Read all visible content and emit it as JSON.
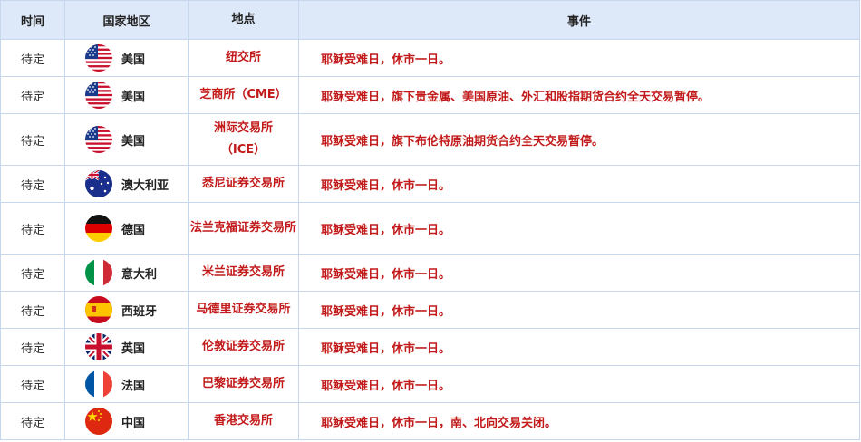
{
  "headers": {
    "time": "时间",
    "country": "国家地区",
    "place": "地点",
    "event": "事件"
  },
  "rows": [
    {
      "time": "待定",
      "flag": "us-flag-icon",
      "country": "美国",
      "place": "纽交所",
      "event": "耶稣受难日，休市一日。"
    },
    {
      "time": "待定",
      "flag": "us-flag-icon",
      "country": "美国",
      "place": "芝商所（CME）",
      "event": "耶稣受难日，旗下贵金属、美国原油、外汇和股指期货合约全天交易暂停。"
    },
    {
      "time": "待定",
      "flag": "us-flag-icon",
      "country": "美国",
      "place": "洲际交易所（ICE）",
      "event": "耶稣受难日，旗下布伦特原油期货合约全天交易暂停。"
    },
    {
      "time": "待定",
      "flag": "au-flag-icon",
      "country": "澳大利亚",
      "place": "悉尼证券交易所",
      "event": "耶稣受难日，休市一日。"
    },
    {
      "time": "待定",
      "flag": "de-flag-icon",
      "country": "德国",
      "place": "法兰克福证券交易所",
      "event": "耶稣受难日，休市一日。"
    },
    {
      "time": "待定",
      "flag": "it-flag-icon",
      "country": "意大利",
      "place": "米兰证券交易所",
      "event": "耶稣受难日，休市一日。"
    },
    {
      "time": "待定",
      "flag": "es-flag-icon",
      "country": "西班牙",
      "place": "马德里证券交易所",
      "event": "耶稣受难日，休市一日。"
    },
    {
      "time": "待定",
      "flag": "gb-flag-icon",
      "country": "英国",
      "place": "伦敦证券交易所",
      "event": "耶稣受难日，休市一日。"
    },
    {
      "time": "待定",
      "flag": "fr-flag-icon",
      "country": "法国",
      "place": "巴黎证券交易所",
      "event": "耶稣受难日，休市一日。"
    },
    {
      "time": "待定",
      "flag": "cn-flag-icon",
      "country": "中国",
      "place": "香港交易所",
      "event": "耶稣受难日，休市一日，南、北向交易关闭。"
    }
  ],
  "colors": {
    "header_bg": "#dde8f8",
    "border": "#c6d6ec",
    "accent_red": "#c21a1a"
  }
}
